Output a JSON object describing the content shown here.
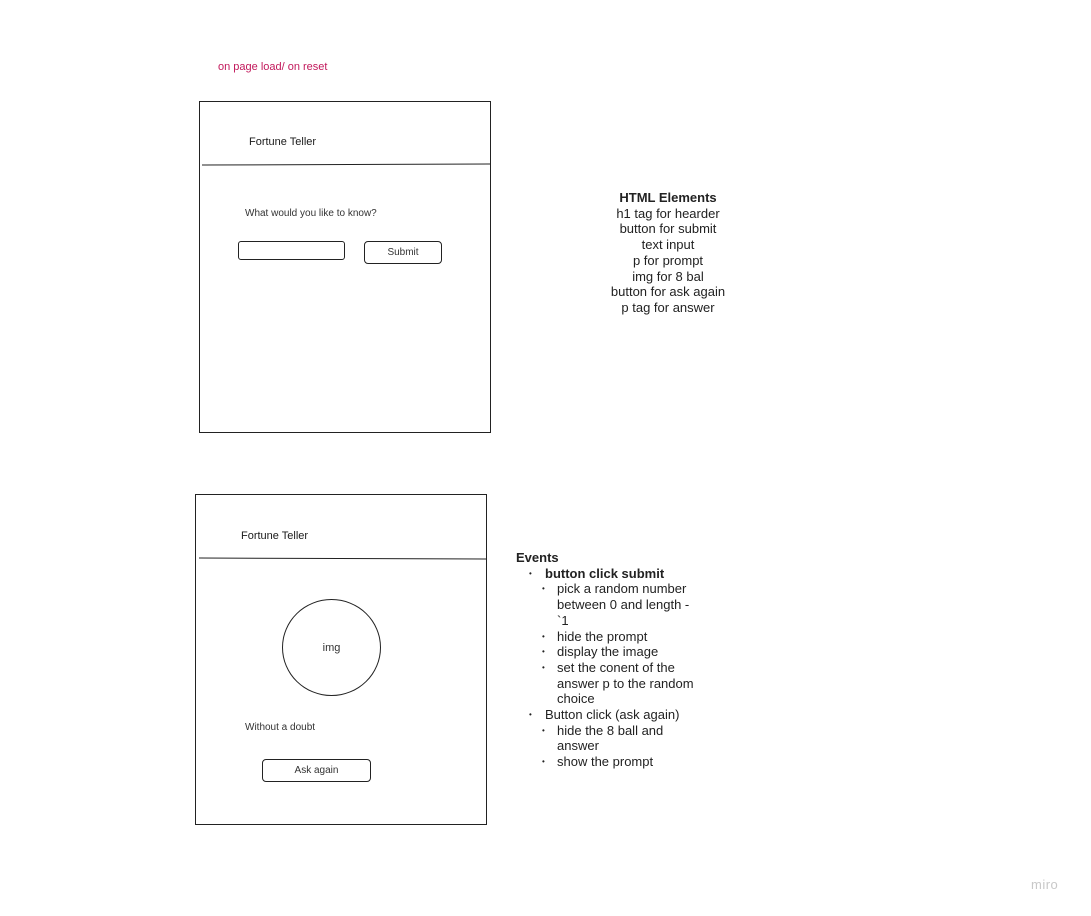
{
  "caption": "on page load/ on reset",
  "wireframe_initial": {
    "title": "Fortune Teller",
    "prompt": "What would you like to know?",
    "input_value": "",
    "submit_label": "Submit"
  },
  "wireframe_result": {
    "title": "Fortune Teller",
    "image_label": "img",
    "answer": "Without a doubt",
    "ask_again_label": "Ask again"
  },
  "html_elements": {
    "heading": "HTML Elements",
    "items": [
      "h1 tag for hearder",
      "button for submit",
      "text input",
      "p for prompt",
      "img for 8 bal",
      "button for ask again",
      "p tag for answer"
    ]
  },
  "events": {
    "heading": "Events",
    "items": [
      {
        "label": "button click submit",
        "subitems": [
          "pick a random number between 0 and length -`1",
          "hide the prompt",
          "display the image",
          "set the conent of the answer p to the random choice"
        ]
      },
      {
        "label": "Button click (ask again)",
        "subitems": [
          "hide the 8 ball and answer",
          "show the prompt"
        ]
      }
    ]
  },
  "watermark": "miro"
}
